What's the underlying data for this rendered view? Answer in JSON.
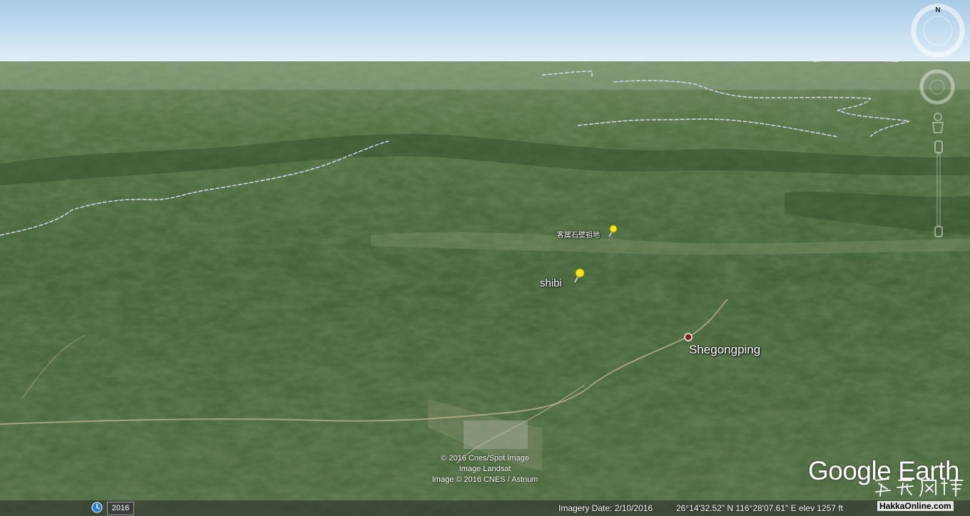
{
  "map": {
    "placemarks": [
      {
        "label": "客属石壁祖地"
      },
      {
        "label": "shibi"
      },
      {
        "label": "Shegongping"
      }
    ]
  },
  "credits": {
    "line1": "© 2016 Cnes/Spot Image",
    "line2": "Image Landsat",
    "line3": "Image © 2016 CNES / Astrium"
  },
  "brand": {
    "google": "Google",
    "earth": "Earth"
  },
  "watermark": {
    "cn": "客家风情",
    "site": "HakkaOnline.com"
  },
  "status": {
    "year": "2016",
    "imagery_date": "Imagery Date: 2/10/2016",
    "coords": "26°14'32.52\" N  116°28'07.61\" E  elev  1257 ft"
  },
  "navigation": {
    "north_label": "N"
  },
  "icons": [
    "compass-icon",
    "look-joystick-icon",
    "move-joystick-icon",
    "pegman-icon",
    "zoom-slider-icon",
    "pushpin-icon",
    "clock-icon"
  ],
  "colors": {
    "pin": "#f5e51b",
    "point": "#8b1a1a",
    "border_line": "#c8d0e8"
  }
}
